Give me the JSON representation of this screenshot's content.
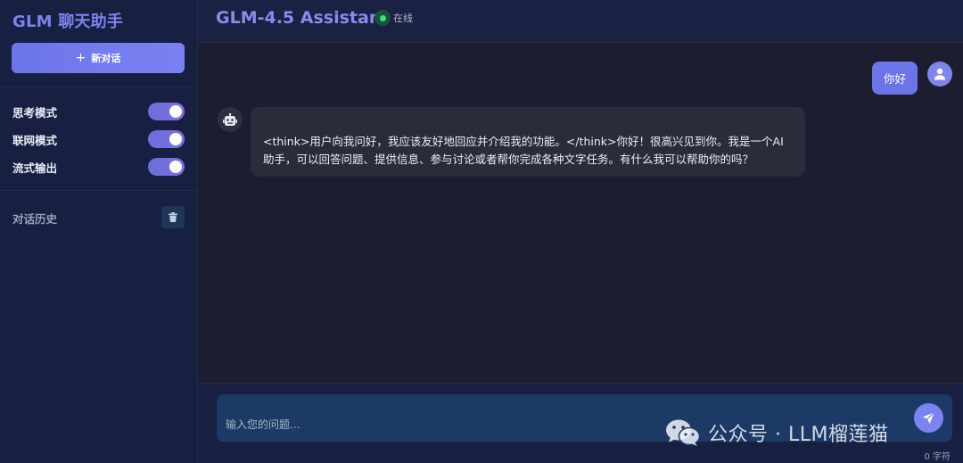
{
  "sidebar": {
    "brand": "GLM 聊天助手",
    "new_chat_icon": "+",
    "new_chat_label": "新对话",
    "toggles": [
      {
        "label": "思考模式",
        "on": true
      },
      {
        "label": "联网模式",
        "on": true
      },
      {
        "label": "流式输出",
        "on": true
      }
    ],
    "history_label": "对话历史"
  },
  "header": {
    "title": "GLM-4.5 Assistant",
    "status": "在线"
  },
  "messages": {
    "user": "你好",
    "bot_line1": "<think>用户向我问好，我应该友好地回应并介绍我的功能。</think>你好！很高兴见到你。我是一个AI",
    "bot_line2": "助手，可以回答问题、提供信息、参与讨论或者帮你完成各种文字任务。有什么我可以帮助你的吗？"
  },
  "input": {
    "placeholder": "输入您的问题...",
    "char_count": "0 字符"
  },
  "watermark": {
    "text": "公众号 · LLM榴莲猫"
  },
  "colors": {
    "accent": "#6c74ea",
    "sidebar_bg": "#172040",
    "chat_bg": "#1c1e30",
    "online": "#3de07c"
  },
  "icons": [
    "plus-icon",
    "trash-icon",
    "user-icon",
    "robot-icon",
    "send-icon",
    "wechat-icon"
  ]
}
